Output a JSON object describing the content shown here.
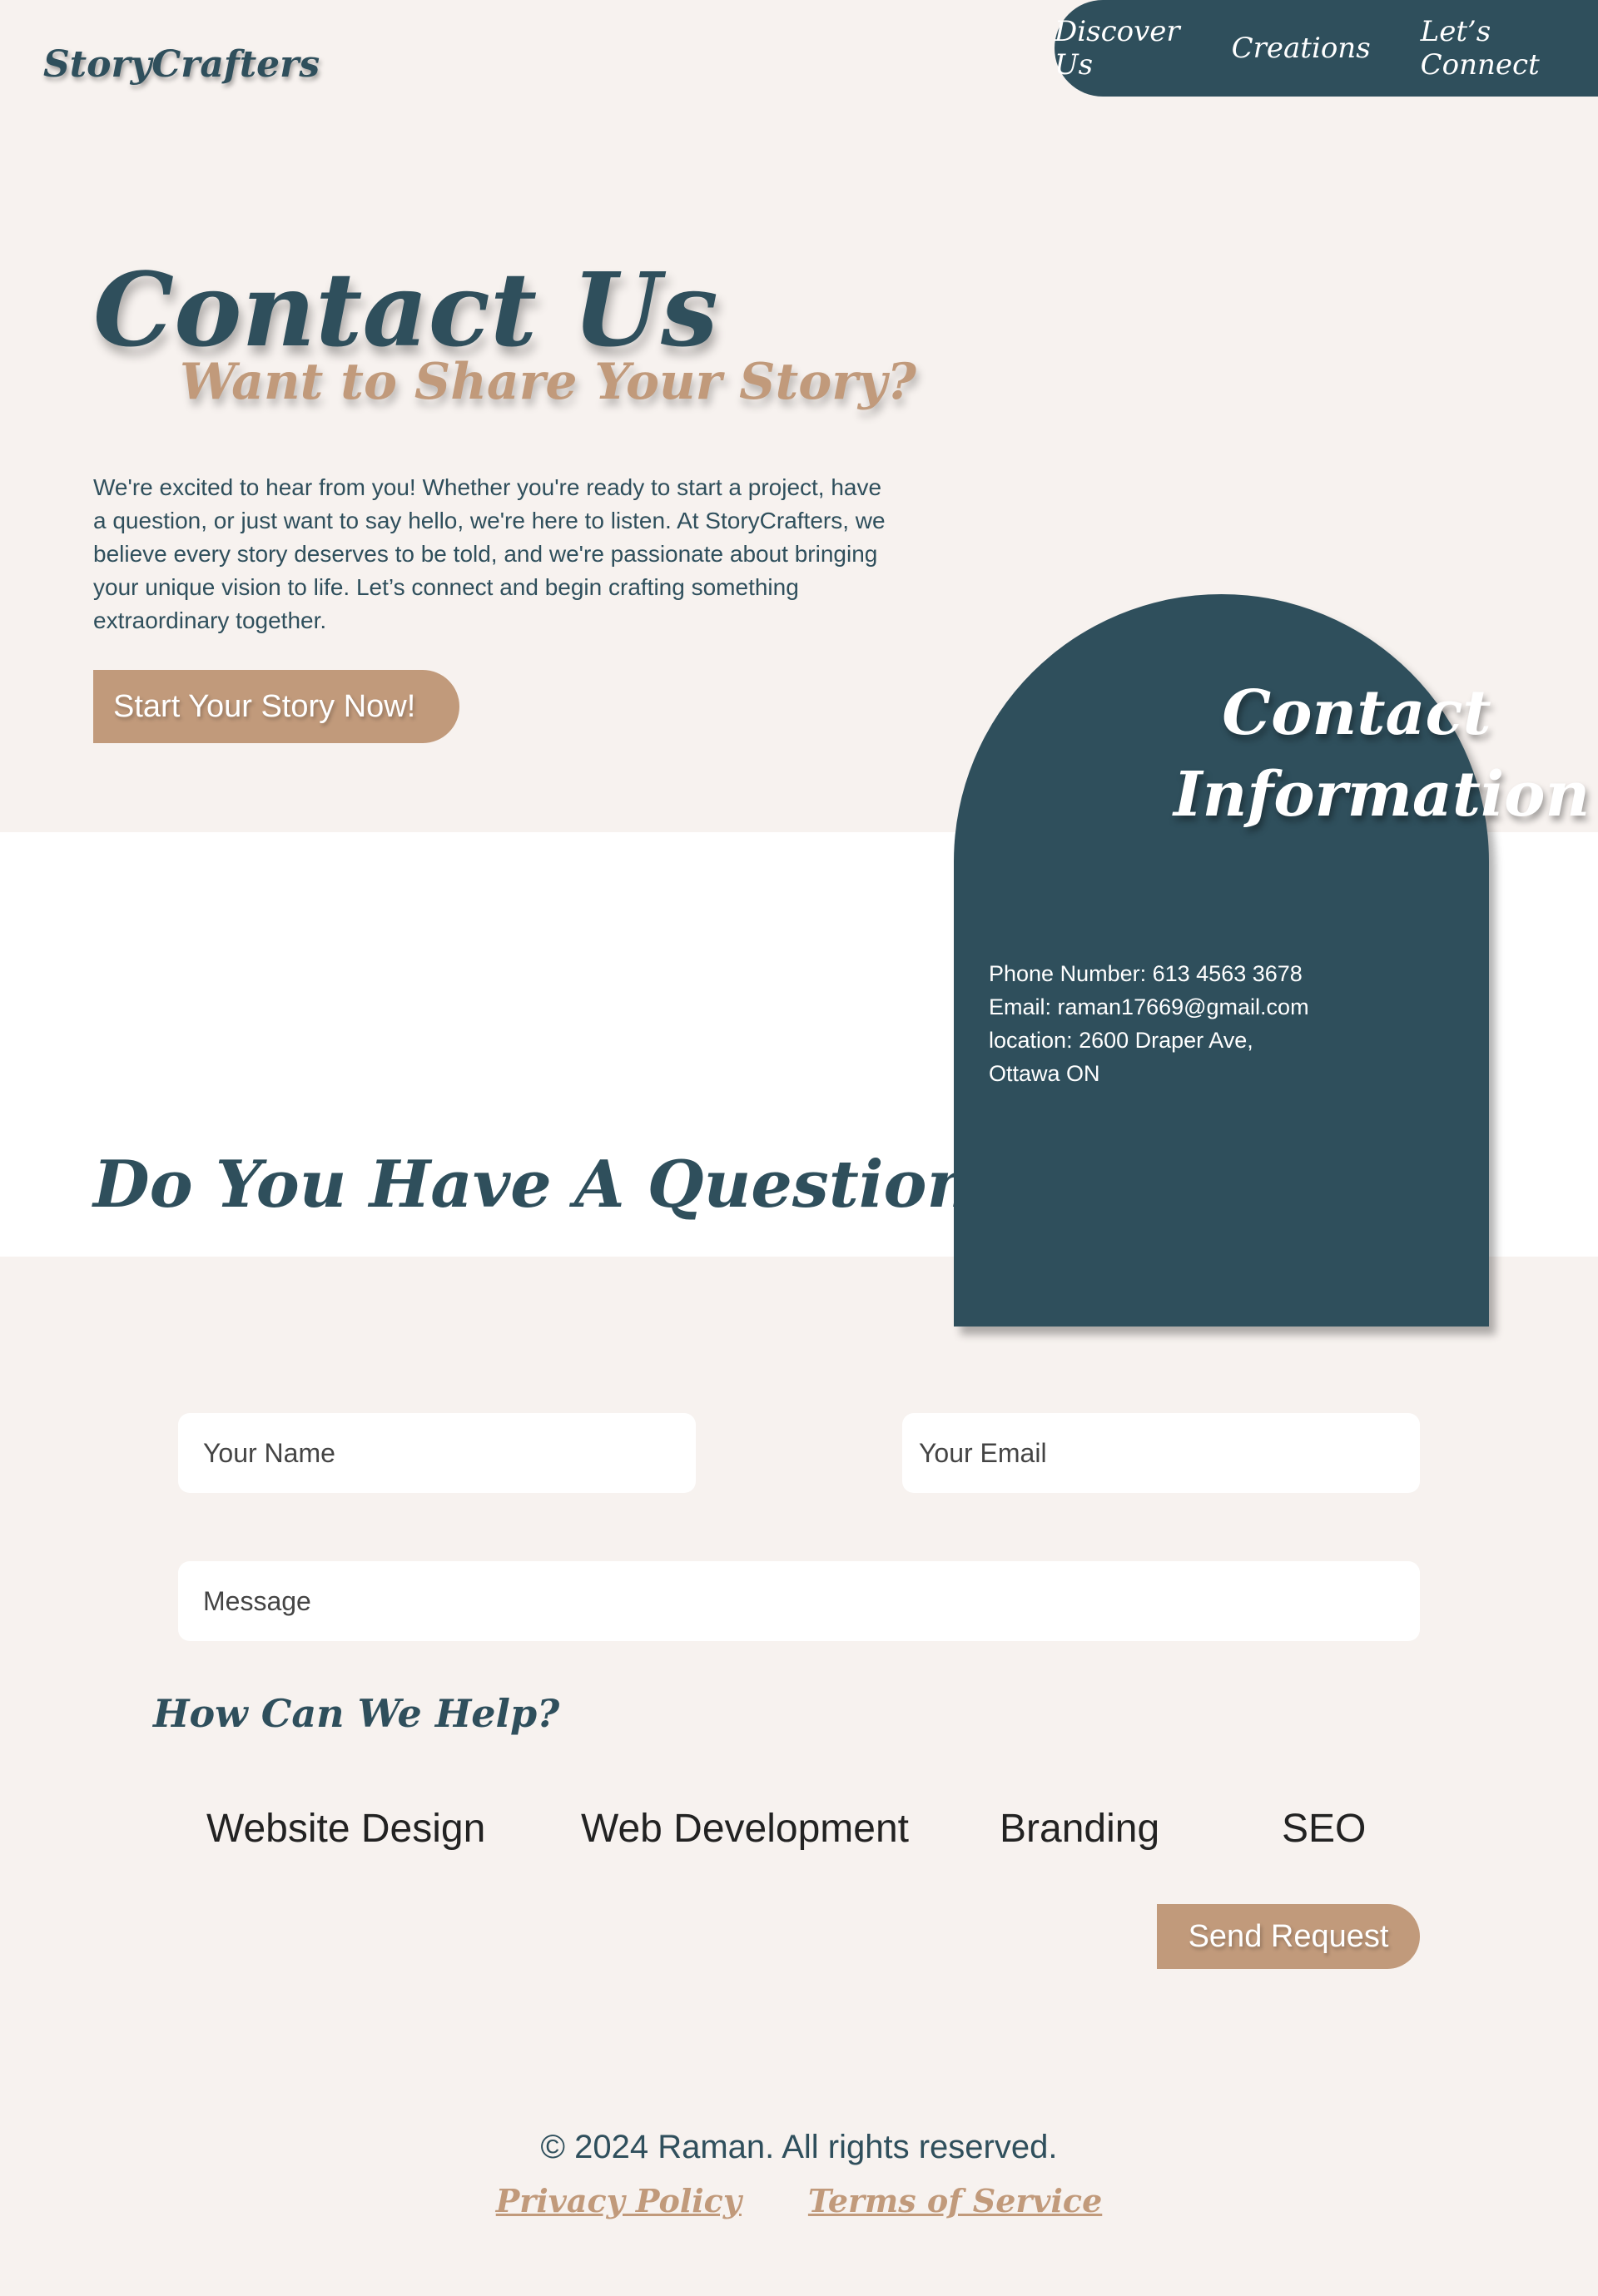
{
  "header": {
    "logo": "StoryCrafters",
    "nav": [
      "Discover Us",
      "Creations",
      "Let’s Connect"
    ]
  },
  "hero": {
    "title": "Contact Us",
    "subtitle": "Want to Share Your Story?",
    "text": "We're excited to hear from you! Whether you're ready to start a project, have a question, or just want to say hello, we're here to listen. At StoryCrafters, we believe every story deserves to be told, and we're passionate about bringing your unique vision to life. Let’s connect and begin crafting something extraordinary together.",
    "cta": "Start Your Story Now!"
  },
  "contact_info": {
    "title": "Contact Information",
    "phone": "Phone Number: 613 4563 3678",
    "email": "Email: raman17669@gmail.com",
    "location_line1": "location: 2600 Draper Ave,",
    "location_line2": "Ottawa ON"
  },
  "question": {
    "title": "Do You Have A Question?"
  },
  "form": {
    "name_placeholder": "Your Name",
    "email_placeholder": "Your Email",
    "message_placeholder": "Message",
    "help_title": "How Can We Help?",
    "services": [
      "Website Design",
      "Web Development",
      "Branding",
      "SEO"
    ],
    "submit": "Send Request"
  },
  "footer": {
    "copyright": "© 2024 Raman. All rights reserved.",
    "links": [
      "Privacy Policy",
      "Terms of Service"
    ]
  },
  "colors": {
    "primary": "#2f4f5c",
    "accent": "#c19a7b",
    "background": "#f7f2ef"
  }
}
